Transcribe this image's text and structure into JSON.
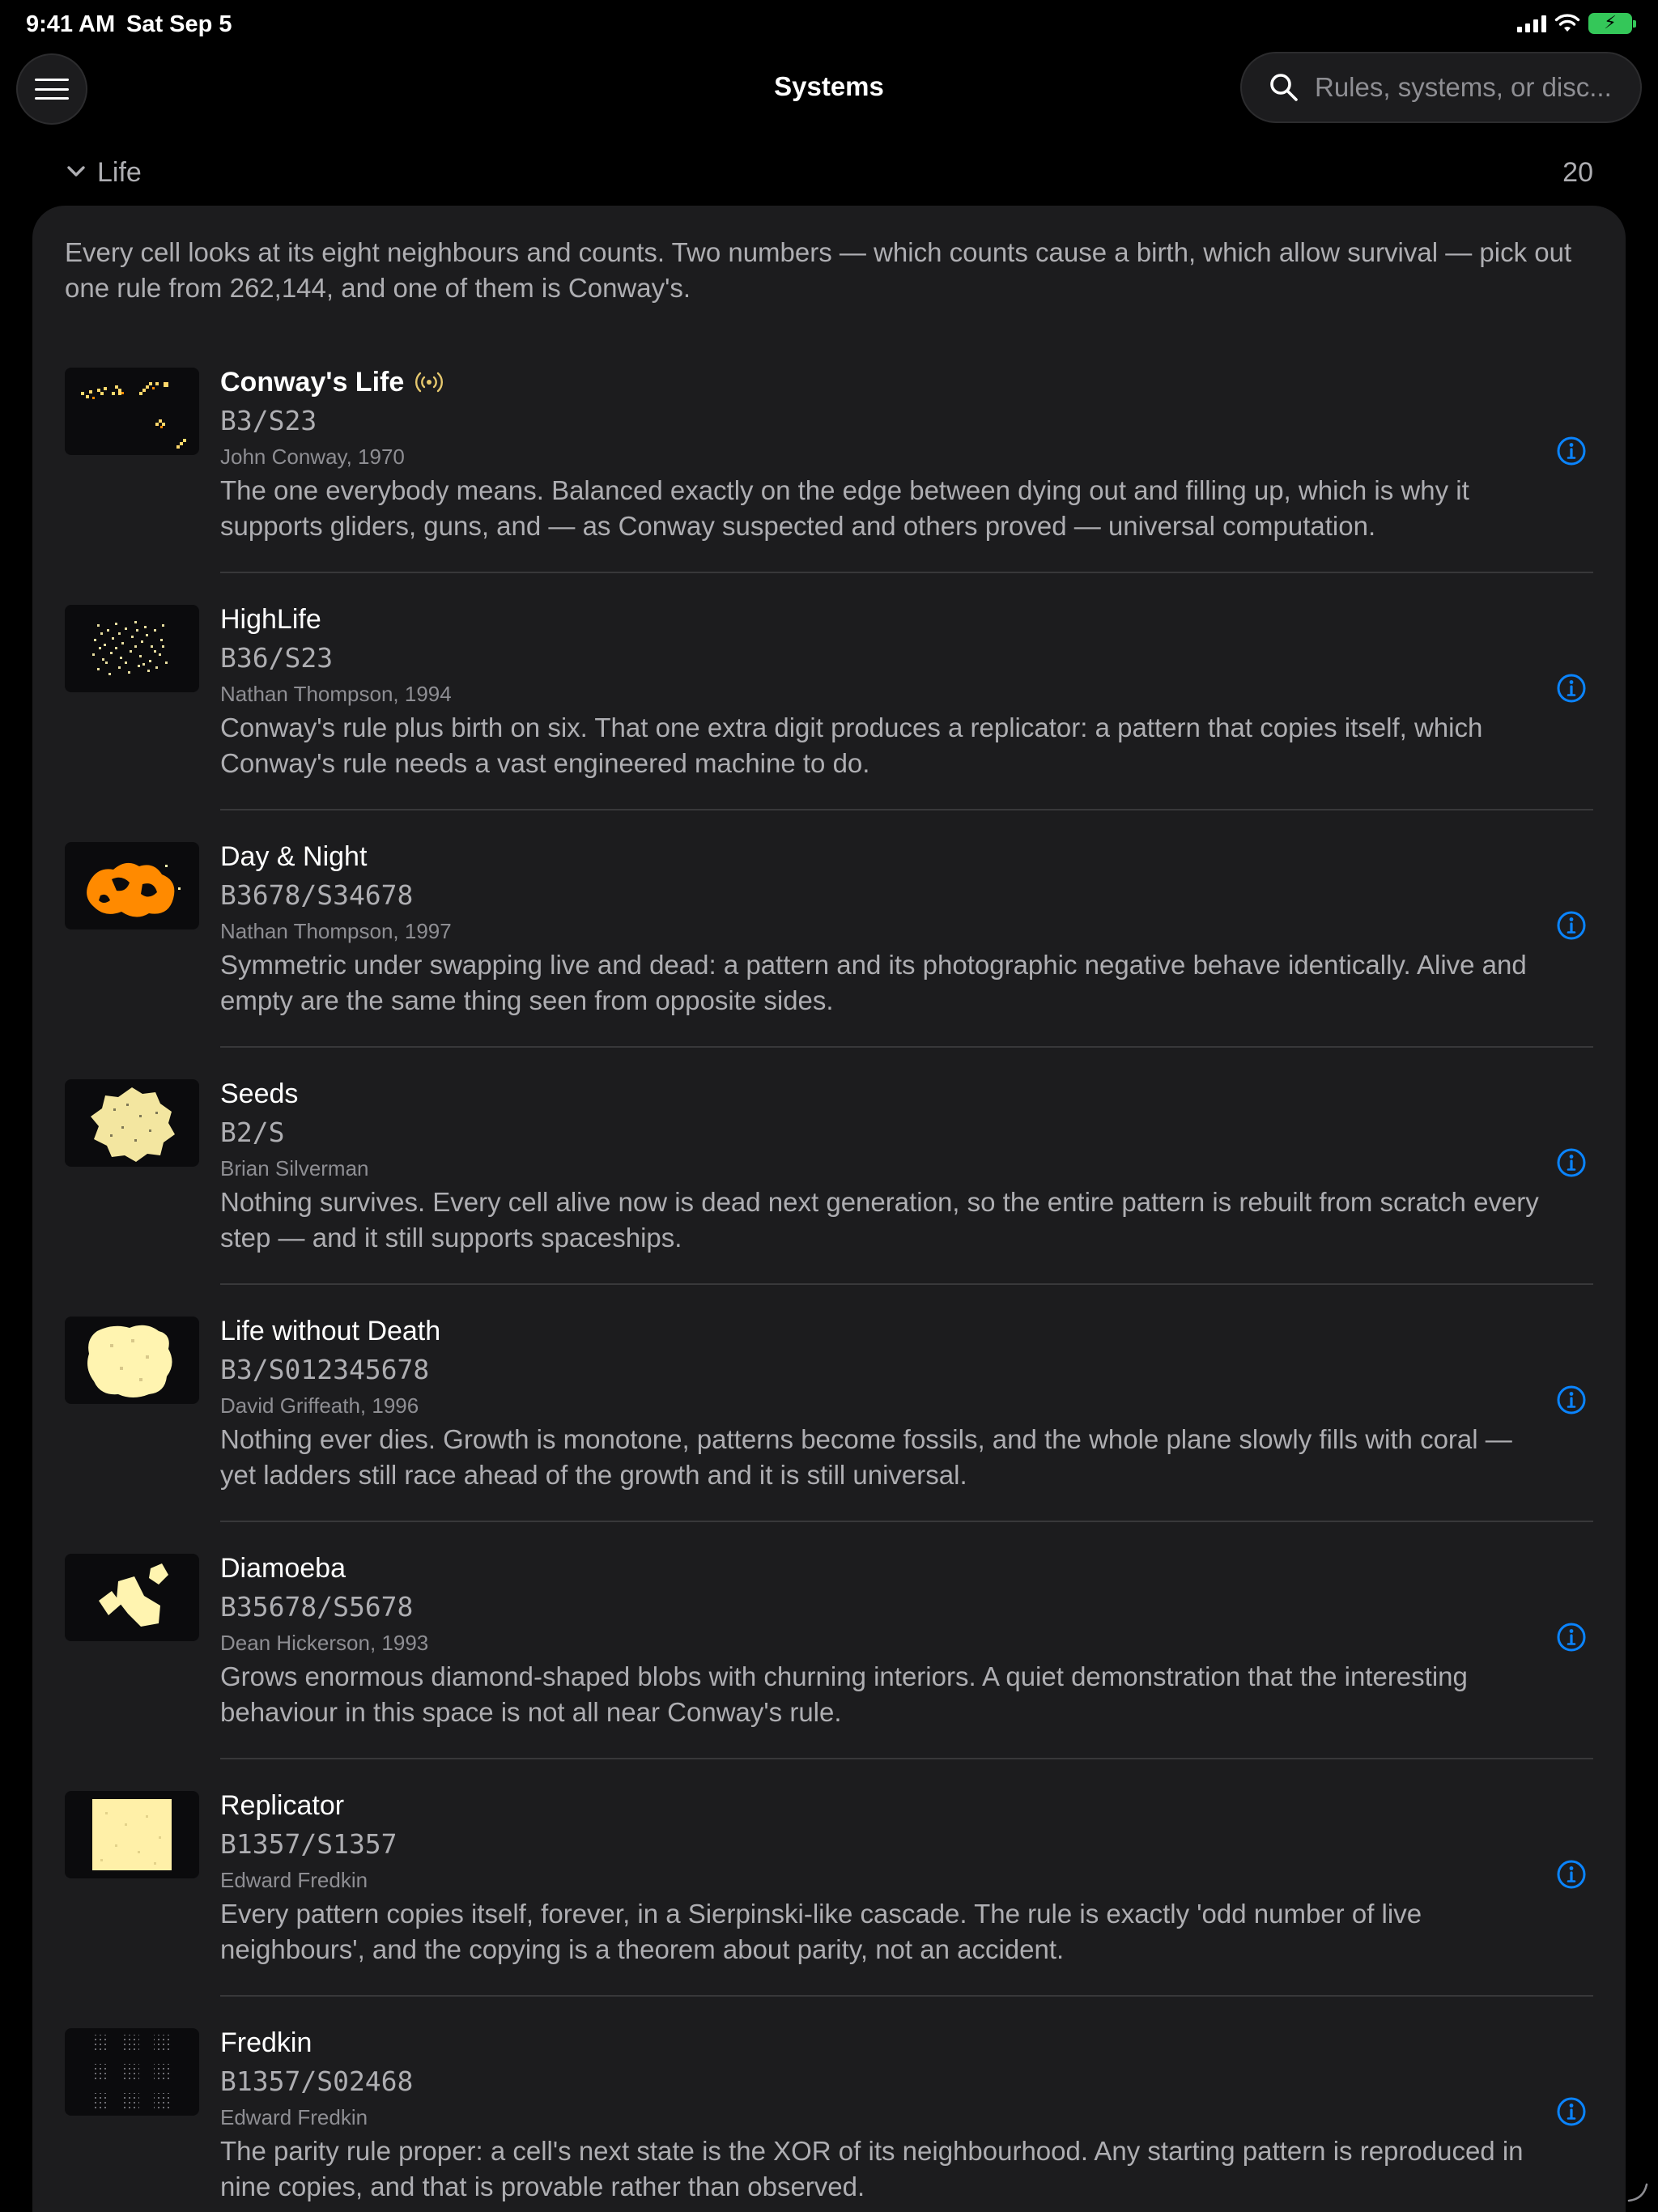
{
  "status_bar": {
    "time": "9:41 AM",
    "date": "Sat Sep 5",
    "icons": [
      "signal-icon",
      "wifi-icon",
      "battery-charging-icon"
    ]
  },
  "nav": {
    "menu_icon": "hamburger-menu-icon",
    "title": "Systems",
    "search_placeholder": "Rules, systems, or disc..."
  },
  "section": {
    "title": "Life",
    "count": "20",
    "intro": "Every cell looks at its eight neighbours and counts. Two numbers — which counts cause a birth, which allow survival — pick out one rule from 262,144, and one of them is Conway's."
  },
  "rules": [
    {
      "name": "Conway's Life",
      "code": "B3/S23",
      "author": "John Conway, 1970",
      "description": "The one everybody means. Balanced exactly on the edge between dying out and filling up, which is why it supports gliders, guns, and — as Conway suspected and others proved — universal computation.",
      "badge_icon": "broadcast-icon",
      "thumb": "gliders"
    },
    {
      "name": "HighLife",
      "code": "B36/S23",
      "author": "Nathan Thompson, 1994",
      "description": "Conway's rule plus birth on six. That one extra digit produces a replicator: a pattern that copies itself, which Conway's rule needs a vast engineered machine to do.",
      "thumb": "scatter"
    },
    {
      "name": "Day & Night",
      "code": "B3678/S34678",
      "author": "Nathan Thompson, 1997",
      "description": "Symmetric under swapping live and dead: a pattern and its photographic negative behave identically. Alive and empty are the same thing seen from opposite sides.",
      "thumb": "orange-blobs"
    },
    {
      "name": "Seeds",
      "code": "B2/S",
      "author": "Brian Silverman",
      "description": "Nothing survives. Every cell alive now is dead next generation, so the entire pattern is rebuilt from scratch every step — and it still supports spaceships.",
      "thumb": "burst"
    },
    {
      "name": "Life without Death",
      "code": "B3/S012345678",
      "author": "David Griffeath, 1996",
      "description": "Nothing ever dies. Growth is monotone, patterns become fossils, and the whole plane slowly fills with coral — yet ladders still race ahead of the growth and it is still universal.",
      "thumb": "coral"
    },
    {
      "name": "Diamoeba",
      "code": "B35678/S5678",
      "author": "Dean Hickerson, 1993",
      "description": "Grows enormous diamond-shaped blobs with churning interiors. A quiet demonstration that the interesting behaviour in this space is not all near Conway's rule.",
      "thumb": "blobs"
    },
    {
      "name": "Replicator",
      "code": "B1357/S1357",
      "author": "Edward Fredkin",
      "description": "Every pattern copies itself, forever, in a Sierpinski-like cascade. The rule is exactly 'odd number of live neighbours', and the copying is a theorem about parity, not an accident.",
      "thumb": "square"
    },
    {
      "name": "Fredkin",
      "code": "B1357/S02468",
      "author": "Edward Fredkin",
      "description": "The parity rule proper: a cell's next state is the XOR of its neighbourhood. Any starting pattern is reproduced in nine copies, and that is provable rather than observed.",
      "thumb": "grid-dots"
    }
  ],
  "colors": {
    "background": "#000000",
    "card": "#1c1c1e",
    "accent_blue": "#0a84ff",
    "cell_yellow": "#fff4b0",
    "cell_orange": "#ff8a00",
    "battery_green": "#34c759"
  }
}
